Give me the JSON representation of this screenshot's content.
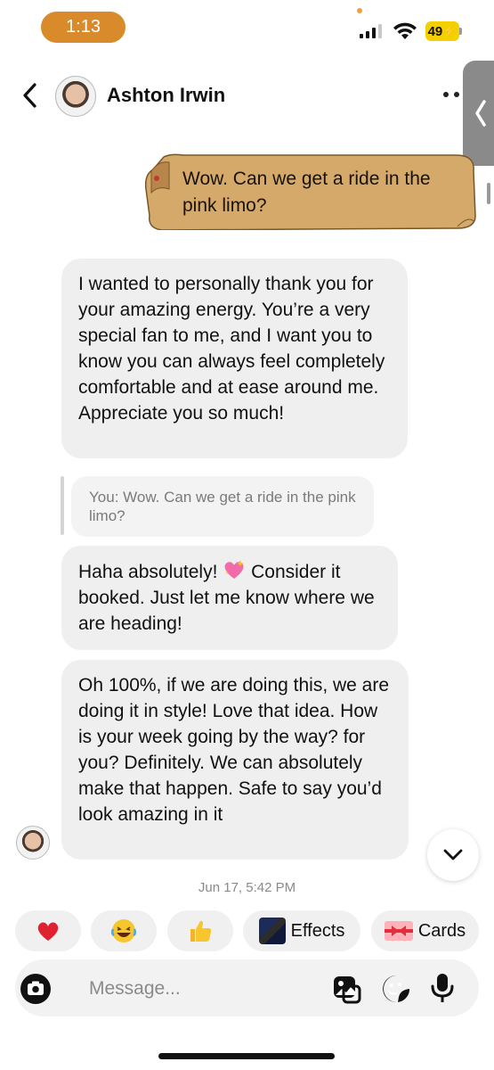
{
  "status_bar": {
    "time": "1:13",
    "battery": "49"
  },
  "header": {
    "contact_name": "Ashton Irwin"
  },
  "messages": {
    "sent_note": "Wow. Can we get a ride in the pink limo?",
    "received_1": "I wanted to personally thank you for your amazing energy. You’re a very special fan to me, and I want you to know you can always feel completely comfortable and at ease around me. Appreciate you so much!",
    "reply_quote": "You: Wow. Can we get a ride in the pink limo?",
    "received_2_part1": "Haha absolutely! ",
    "received_2_part2": " Consider it booked. Just let me know where we are heading!",
    "received_3": "Oh 100%, if we are doing this, we are doing it in style! Love that idea. How is your week going by the way? for you? Definitely. We can absolutely make that happen. Safe to say you’d look amazing in it",
    "timestamp": "Jun 17, 5:42 PM"
  },
  "quick_actions": {
    "effects_label": "Effects",
    "cards_label": "Cards",
    "reactions": [
      "heart-emoji",
      "laughing-emoji",
      "thumbs-up-emoji"
    ]
  },
  "composer": {
    "placeholder": "Message..."
  },
  "colors": {
    "time_pill": "#d98a2b",
    "battery": "#f5d000",
    "received_bubble": "#efefef",
    "scroll_paper": "#d4a96a"
  }
}
